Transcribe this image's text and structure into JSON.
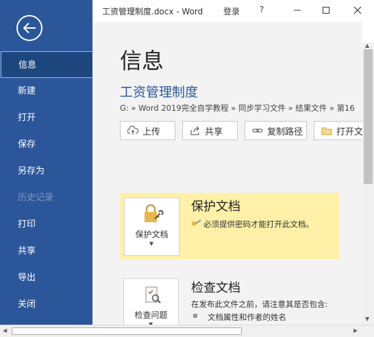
{
  "window": {
    "doc_title": "工资管理制度.docx - Word",
    "login": "登录",
    "help": "?"
  },
  "sidebar": {
    "items": [
      {
        "label": "信息"
      },
      {
        "label": "新建"
      },
      {
        "label": "打开"
      },
      {
        "label": "保存"
      },
      {
        "label": "另存为"
      },
      {
        "label": "历史记录"
      },
      {
        "label": "打印"
      },
      {
        "label": "共享"
      },
      {
        "label": "导出"
      },
      {
        "label": "关闭"
      }
    ]
  },
  "main": {
    "title": "信息",
    "doc_name": "工资管理制度",
    "path": "G: » Word 2019完全自学教程 » 同步学习文件 » 结果文件 » 第16",
    "buttons": {
      "upload": "上传",
      "share": "共享",
      "copy_path": "复制路径",
      "open_location": "打开文"
    },
    "protect": {
      "card_label": "保护文档",
      "title": "保护文档",
      "desc": "必须提供密码才能打开此文档。"
    },
    "inspect": {
      "card_label": "检查问题",
      "title": "检查文档",
      "desc": "在发布此文件之前，请注意其是否包含:",
      "bullet": "文档属性和作者的姓名"
    }
  },
  "colors": {
    "sidebar": "#2b579a",
    "accent": "#2b579a",
    "protect_bg": "#fff0a8"
  }
}
